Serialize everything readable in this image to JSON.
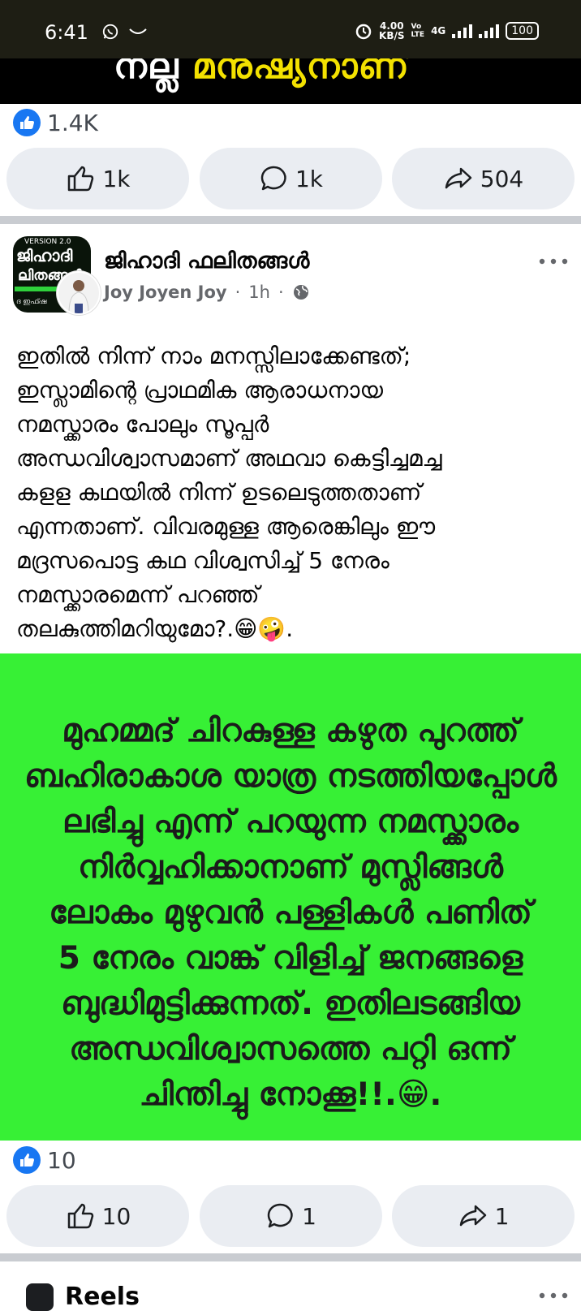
{
  "status_bar": {
    "time": "6:41",
    "speed_value": "4.00",
    "speed_unit": "KB/S",
    "volte_top": "Vo",
    "volte_bottom": "LTE",
    "network": "4G",
    "battery": "100"
  },
  "previous_post": {
    "banner_text_white": "നല്ല",
    "banner_text_yellow": " മനുഷ്യനാണ്",
    "reaction_count": "1.4K",
    "like_count": "1k",
    "comment_count": "1k",
    "share_count": "504"
  },
  "post": {
    "page_name": "ജിഹാദി ഫലിതങ്ങൾ",
    "page_avatar": {
      "version": "VERSION 2.0",
      "line1": "ജിഹാദി",
      "line2": "ലിതങ്ങൾ",
      "line3": "ദ ഇഫ്ഷ"
    },
    "author": "Joy Joyen Joy",
    "time": "1h",
    "separator": "·",
    "text_lines": [
      "ഇതിൽ നിന്ന് നാം  മനസ്സിലാക്കേണ്ടത്;",
      "ഇസ്ലാമിന്റെ പ്രാഥമിക ആരാധനായ",
      "നമസ്ക്കാരം പോലും സൂപ്പർ",
      "അന്ധവിശ്വാസമാണ് അഥവാ കെട്ടിച്ചമച്ച",
      "കളള കഥയിൽ നിന്ന് ഉടലെടുത്തതാണ്",
      "എന്നതാണ്. വിവരമുള്ള  ആരെങ്കിലും ഈ",
      "മദ്രസപൊട്ട കഥ വിശ്വസിച്ച് 5 നേരം",
      "നമസ്ക്കാരമെന്ന് പറഞ്ഞ്",
      "തലകുത്തിമറിയുമോ?.😁🤪."
    ],
    "image_text_lines": [
      "മുഹമ്മദ് ചിറകുള്ള കഴുത പുറത്ത്",
      "ബഹിരാകാശ യാത്ര നടത്തിയപ്പോൾ",
      "ലഭിച്ചു എന്ന് പറയുന്ന നമസ്ക്കാരം",
      "നിർവ്വഹിക്കാനാണ് മുസ്ലിങ്ങൾ",
      "ലോകം മുഴുവൻ പള്ളികൾ പണിത്",
      "5 നേരം വാങ്ക് വിളിച്ച് ജനങ്ങളെ",
      "ബുദ്ധിമുട്ടിക്കുന്നത്. ഇതിലടങ്ങിയ",
      "അന്ധവിശ്വാസത്തെ പറ്റി ഒന്ന്",
      "ചിന്തിച്ചു നോക്കൂ!!.😁."
    ],
    "image_bg_color": "#37f035",
    "reaction_count": "10",
    "like_count": "10",
    "comment_count": "1",
    "share_count": "1"
  },
  "reels": {
    "label": "Reels"
  },
  "colors": {
    "like_blue": "#1877f2",
    "action_bg": "#eaedf2",
    "divider": "#c9ccd1"
  },
  "icons": [
    "whatsapp-icon",
    "alarm-icon",
    "signal-icon",
    "battery-icon",
    "like-icon",
    "comment-icon",
    "share-icon",
    "globe-icon",
    "more-icon",
    "reels-icon"
  ]
}
